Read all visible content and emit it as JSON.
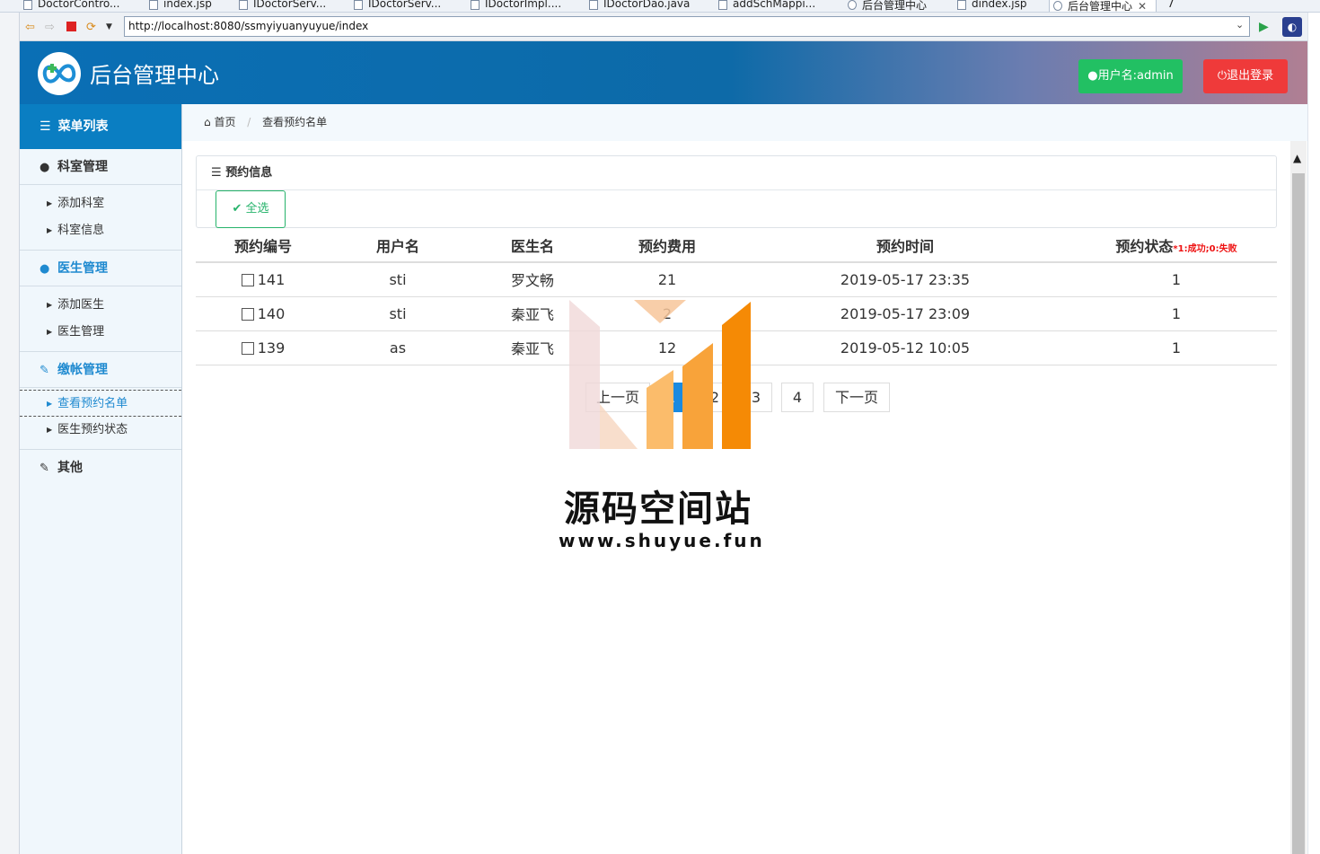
{
  "ide_tabs": [
    {
      "label": "DoctorContro..."
    },
    {
      "label": "index.jsp"
    },
    {
      "label": "IDoctorServ..."
    },
    {
      "label": "IDoctorServ..."
    },
    {
      "label": "IDoctorImpl...."
    },
    {
      "label": "IDoctorDao.java"
    },
    {
      "label": "addSchMappi..."
    },
    {
      "label": "后台管理中心"
    },
    {
      "label": "dindex.jsp"
    },
    {
      "label": "后台管理中心"
    },
    {
      "label": "7"
    }
  ],
  "browser": {
    "url": "http://localhost:8080/ssmyiyuanyuyue/index"
  },
  "header": {
    "title": "后台管理中心",
    "user_label": "用户名:admin",
    "logout_label": "退出登录"
  },
  "sidebar": {
    "heading": "菜单列表",
    "groups": [
      {
        "label": "科室管理",
        "items": [
          "添加科室",
          "科室信息"
        ]
      },
      {
        "label": "医生管理",
        "items": [
          "添加医生",
          "医生管理"
        ]
      },
      {
        "label": "缴帐管理",
        "items": [
          "查看预约名单",
          "医生预约状态"
        ]
      },
      {
        "label": "其他",
        "items": []
      }
    ]
  },
  "breadcrumb": {
    "home": "首页",
    "current": "查看预约名单"
  },
  "panel": {
    "title": "预约信息",
    "select_all": "全选"
  },
  "table": {
    "headers": [
      "预约编号",
      "用户名",
      "医生名",
      "预约费用",
      "预约时间",
      "预约状态"
    ],
    "status_note": "*1:成功;0:失败",
    "rows": [
      {
        "id": "141",
        "user": "sti",
        "doctor": "罗文畅",
        "fee": "21",
        "time": "2019-05-17 23:35",
        "status": "1"
      },
      {
        "id": "140",
        "user": "sti",
        "doctor": "秦亚飞",
        "fee": "2",
        "time": "2019-05-17 23:09",
        "status": "1"
      },
      {
        "id": "139",
        "user": "as",
        "doctor": "秦亚飞",
        "fee": "12",
        "time": "2019-05-12 10:05",
        "status": "1"
      }
    ]
  },
  "pager": {
    "prev": "上一页",
    "pages": [
      "1",
      "2",
      "3",
      "4"
    ],
    "current": "1",
    "next": "下一页"
  },
  "watermark": {
    "name": "源码空间站",
    "url": "www.shuyue.fun"
  }
}
